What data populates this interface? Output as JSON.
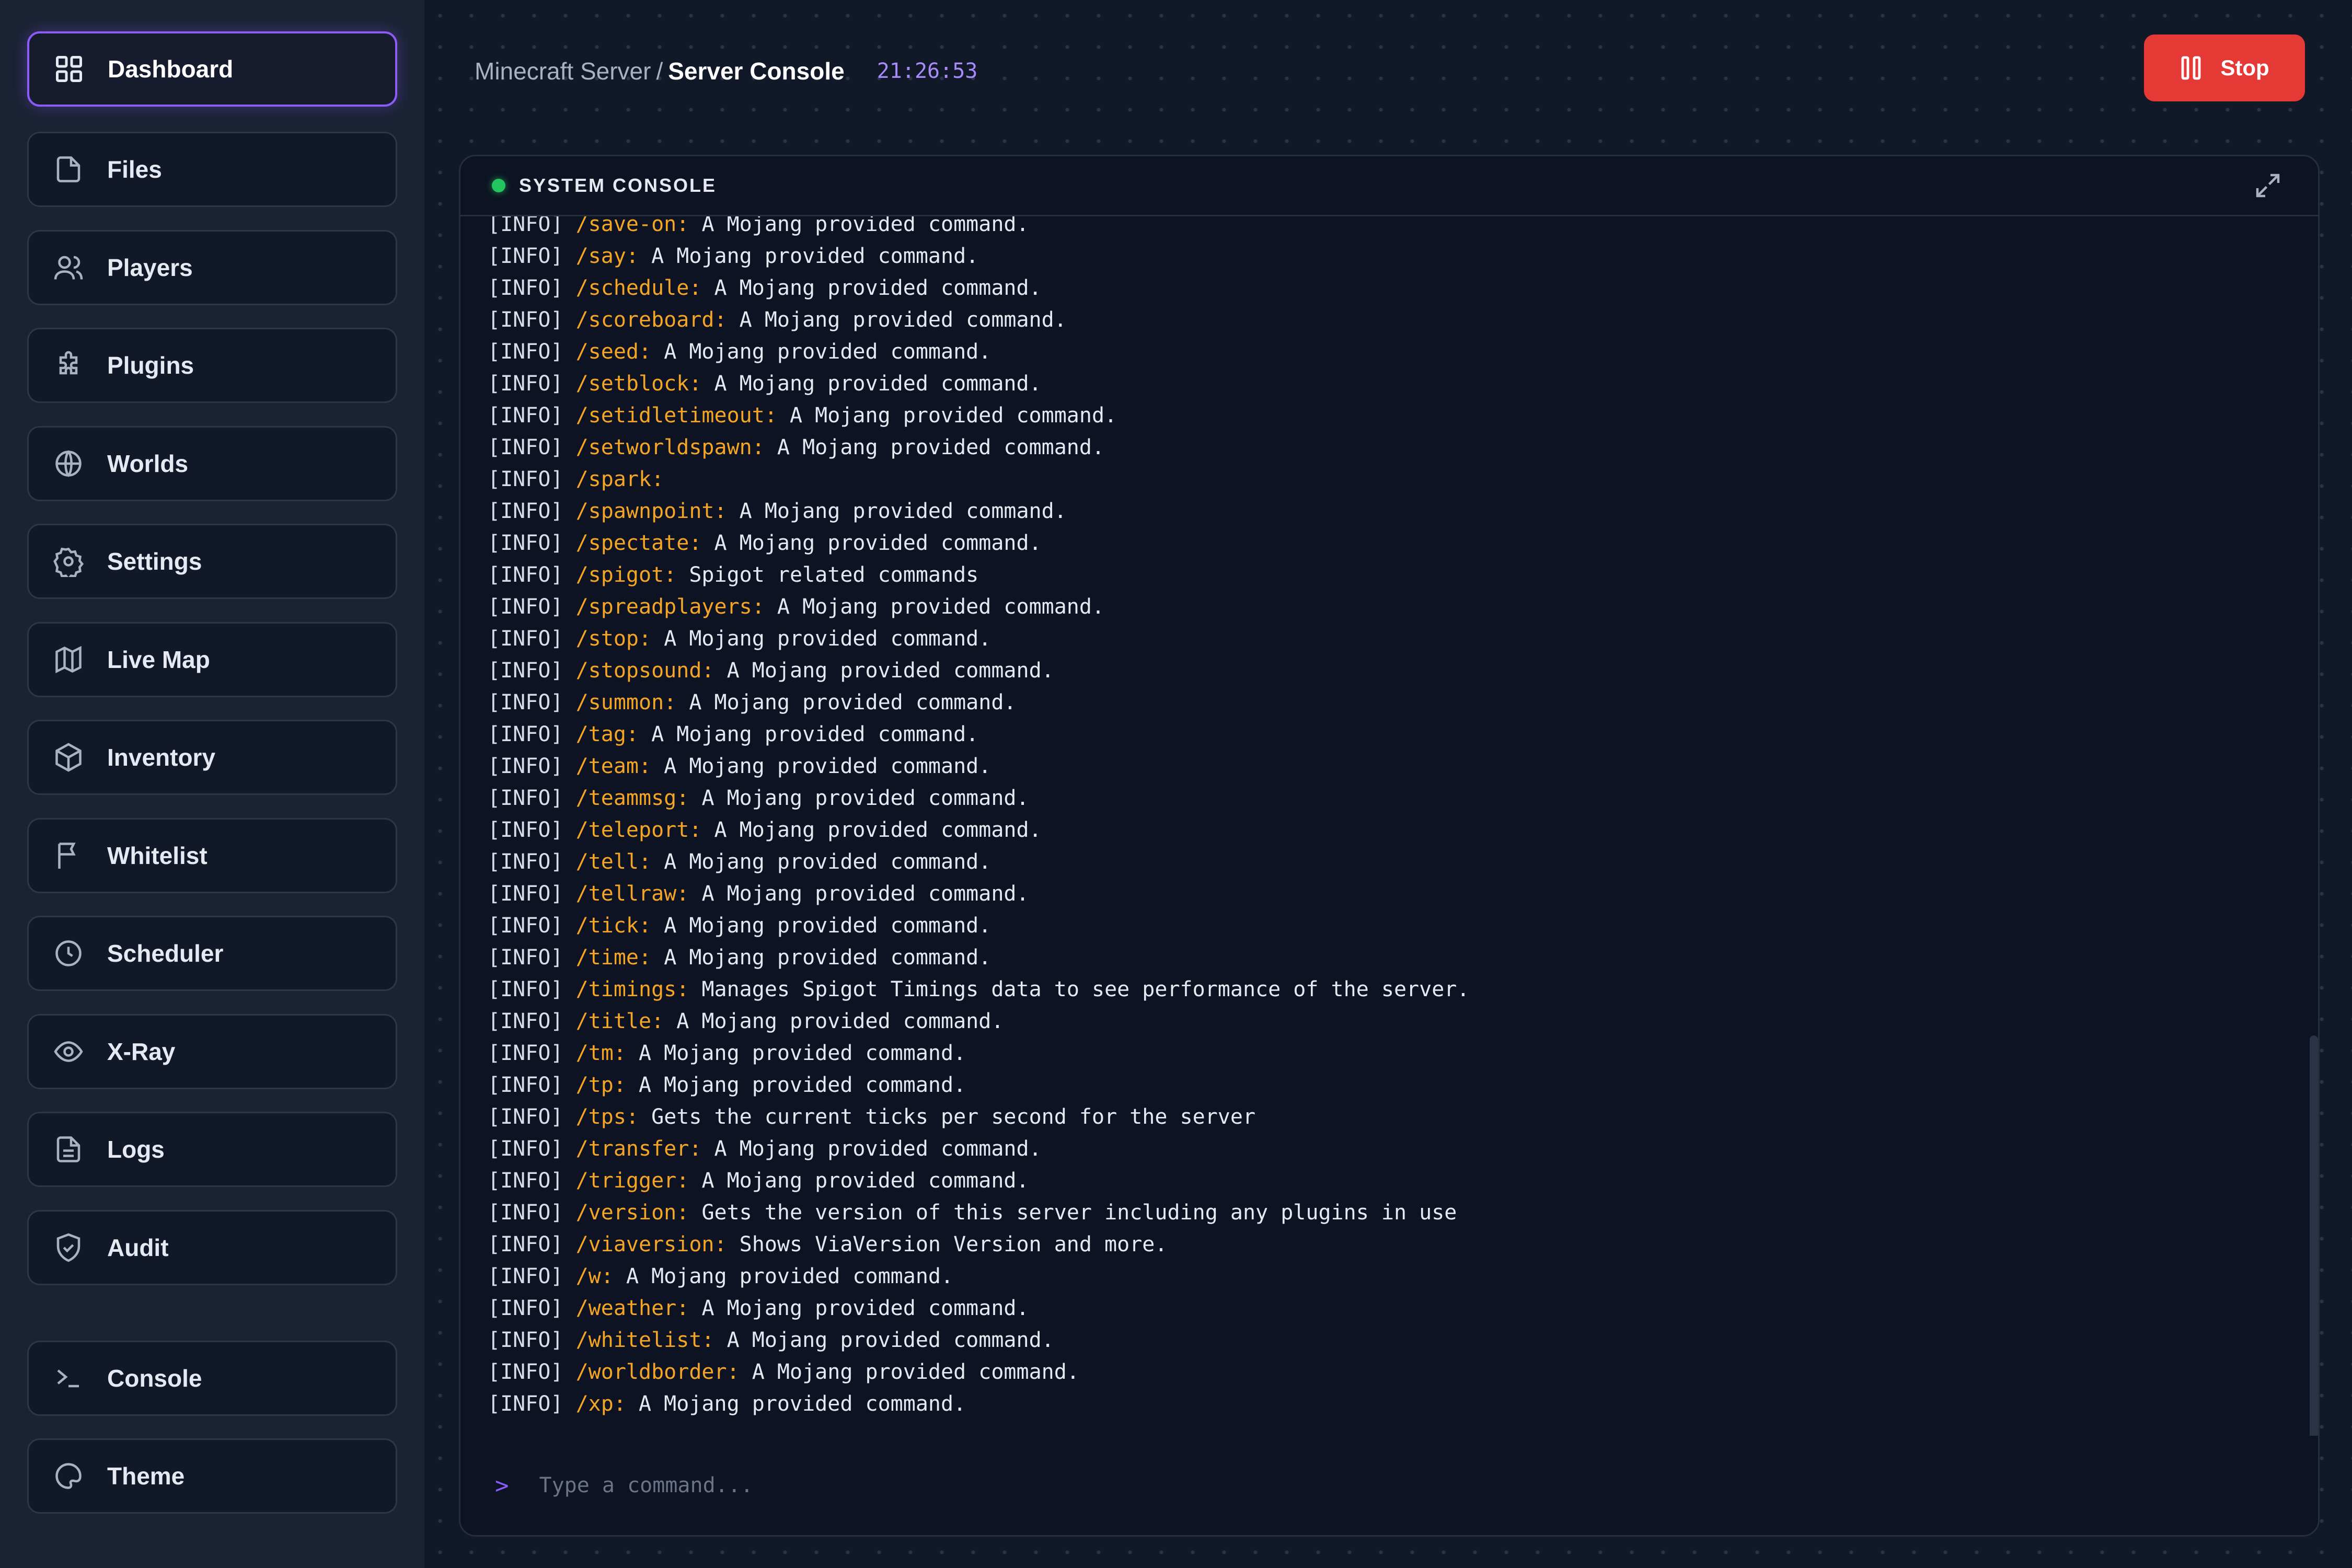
{
  "sidebar": {
    "items": [
      {
        "label": "Dashboard",
        "icon": "grid-icon"
      },
      {
        "label": "Files",
        "icon": "file-icon"
      },
      {
        "label": "Players",
        "icon": "users-icon"
      },
      {
        "label": "Plugins",
        "icon": "puzzle-icon"
      },
      {
        "label": "Worlds",
        "icon": "globe-icon"
      },
      {
        "label": "Settings",
        "icon": "gear-icon"
      },
      {
        "label": "Live Map",
        "icon": "map-icon"
      },
      {
        "label": "Inventory",
        "icon": "box-icon"
      },
      {
        "label": "Whitelist",
        "icon": "flag-icon"
      },
      {
        "label": "Scheduler",
        "icon": "clock-icon"
      },
      {
        "label": "X-Ray",
        "icon": "eye-icon"
      },
      {
        "label": "Logs",
        "icon": "document-icon"
      },
      {
        "label": "Audit",
        "icon": "shield-icon"
      }
    ],
    "bottom_items": [
      {
        "label": "Console",
        "icon": "terminal-icon"
      },
      {
        "label": "Theme",
        "icon": "palette-icon"
      }
    ]
  },
  "header": {
    "breadcrumb_parent": "Minecraft Server",
    "breadcrumb_separator": "/",
    "breadcrumb_current": "Server Console",
    "clock": "21:26:53",
    "stop_label": "Stop"
  },
  "console": {
    "title": "SYSTEM CONSOLE",
    "status_color": "#22c55e",
    "prompt": ">",
    "input_placeholder": "Type a command...",
    "lines": [
      {
        "tag": "[INFO]",
        "cmd": "/save-on:",
        "desc": "A Mojang provided command."
      },
      {
        "tag": "[INFO]",
        "cmd": "/say:",
        "desc": "A Mojang provided command."
      },
      {
        "tag": "[INFO]",
        "cmd": "/schedule:",
        "desc": "A Mojang provided command."
      },
      {
        "tag": "[INFO]",
        "cmd": "/scoreboard:",
        "desc": "A Mojang provided command."
      },
      {
        "tag": "[INFO]",
        "cmd": "/seed:",
        "desc": "A Mojang provided command."
      },
      {
        "tag": "[INFO]",
        "cmd": "/setblock:",
        "desc": "A Mojang provided command."
      },
      {
        "tag": "[INFO]",
        "cmd": "/setidletimeout:",
        "desc": "A Mojang provided command."
      },
      {
        "tag": "[INFO]",
        "cmd": "/setworldspawn:",
        "desc": "A Mojang provided command."
      },
      {
        "tag": "[INFO]",
        "cmd": "/spark:",
        "desc": ""
      },
      {
        "tag": "[INFO]",
        "cmd": "/spawnpoint:",
        "desc": "A Mojang provided command."
      },
      {
        "tag": "[INFO]",
        "cmd": "/spectate:",
        "desc": "A Mojang provided command."
      },
      {
        "tag": "[INFO]",
        "cmd": "/spigot:",
        "desc": "Spigot related commands"
      },
      {
        "tag": "[INFO]",
        "cmd": "/spreadplayers:",
        "desc": "A Mojang provided command."
      },
      {
        "tag": "[INFO]",
        "cmd": "/stop:",
        "desc": "A Mojang provided command."
      },
      {
        "tag": "[INFO]",
        "cmd": "/stopsound:",
        "desc": "A Mojang provided command."
      },
      {
        "tag": "[INFO]",
        "cmd": "/summon:",
        "desc": "A Mojang provided command."
      },
      {
        "tag": "[INFO]",
        "cmd": "/tag:",
        "desc": "A Mojang provided command."
      },
      {
        "tag": "[INFO]",
        "cmd": "/team:",
        "desc": "A Mojang provided command."
      },
      {
        "tag": "[INFO]",
        "cmd": "/teammsg:",
        "desc": "A Mojang provided command."
      },
      {
        "tag": "[INFO]",
        "cmd": "/teleport:",
        "desc": "A Mojang provided command."
      },
      {
        "tag": "[INFO]",
        "cmd": "/tell:",
        "desc": "A Mojang provided command."
      },
      {
        "tag": "[INFO]",
        "cmd": "/tellraw:",
        "desc": "A Mojang provided command."
      },
      {
        "tag": "[INFO]",
        "cmd": "/tick:",
        "desc": "A Mojang provided command."
      },
      {
        "tag": "[INFO]",
        "cmd": "/time:",
        "desc": "A Mojang provided command."
      },
      {
        "tag": "[INFO]",
        "cmd": "/timings:",
        "desc": "Manages Spigot Timings data to see performance of the server."
      },
      {
        "tag": "[INFO]",
        "cmd": "/title:",
        "desc": "A Mojang provided command."
      },
      {
        "tag": "[INFO]",
        "cmd": "/tm:",
        "desc": "A Mojang provided command."
      },
      {
        "tag": "[INFO]",
        "cmd": "/tp:",
        "desc": "A Mojang provided command."
      },
      {
        "tag": "[INFO]",
        "cmd": "/tps:",
        "desc": "Gets the current ticks per second for the server"
      },
      {
        "tag": "[INFO]",
        "cmd": "/transfer:",
        "desc": "A Mojang provided command."
      },
      {
        "tag": "[INFO]",
        "cmd": "/trigger:",
        "desc": "A Mojang provided command."
      },
      {
        "tag": "[INFO]",
        "cmd": "/version:",
        "desc": "Gets the version of this server including any plugins in use"
      },
      {
        "tag": "[INFO]",
        "cmd": "/viaversion:",
        "desc": "Shows ViaVersion Version and more."
      },
      {
        "tag": "[INFO]",
        "cmd": "/w:",
        "desc": "A Mojang provided command."
      },
      {
        "tag": "[INFO]",
        "cmd": "/weather:",
        "desc": "A Mojang provided command."
      },
      {
        "tag": "[INFO]",
        "cmd": "/whitelist:",
        "desc": "A Mojang provided command."
      },
      {
        "tag": "[INFO]",
        "cmd": "/worldborder:",
        "desc": "A Mojang provided command."
      },
      {
        "tag": "[INFO]",
        "cmd": "/xp:",
        "desc": "A Mojang provided command."
      }
    ]
  },
  "colors": {
    "accent": "#8b5cf6",
    "stop": "#e53935",
    "command": "#f5a524",
    "clock": "#a78bfa"
  }
}
